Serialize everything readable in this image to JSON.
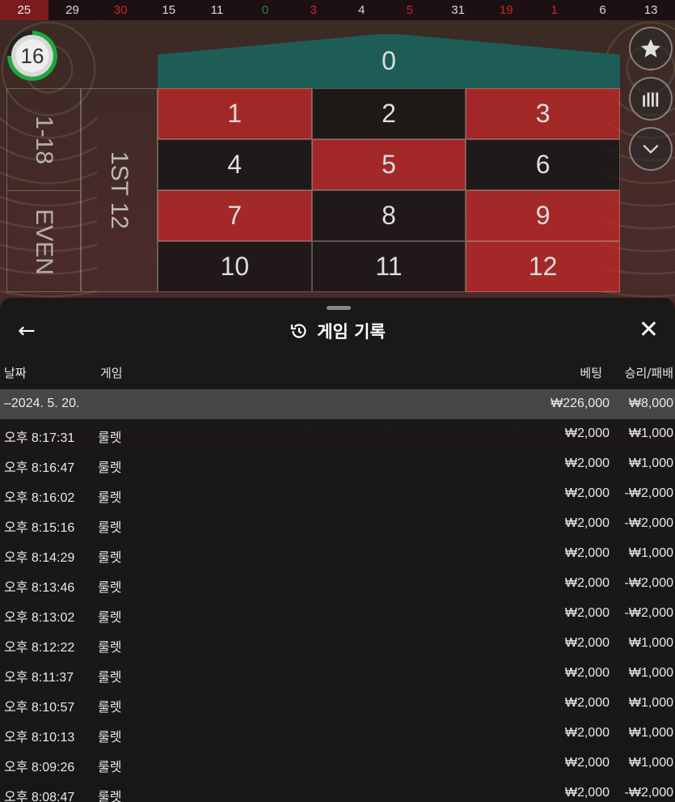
{
  "results": [
    {
      "value": "25",
      "color": "black",
      "latest": true
    },
    {
      "value": "29",
      "color": "black"
    },
    {
      "value": "30",
      "color": "red"
    },
    {
      "value": "15",
      "color": "black"
    },
    {
      "value": "11",
      "color": "black"
    },
    {
      "value": "0",
      "color": "green"
    },
    {
      "value": "3",
      "color": "red"
    },
    {
      "value": "4",
      "color": "black"
    },
    {
      "value": "5",
      "color": "red"
    },
    {
      "value": "31",
      "color": "black"
    },
    {
      "value": "19",
      "color": "red"
    },
    {
      "value": "1",
      "color": "red"
    },
    {
      "value": "6",
      "color": "black"
    },
    {
      "value": "13",
      "color": "black"
    }
  ],
  "timer": "16",
  "side_buttons": [
    "star-icon",
    "statistics-icon",
    "chevron-down-icon"
  ],
  "table": {
    "zero": "0",
    "cells": [
      {
        "n": "1",
        "c": "red"
      },
      {
        "n": "2",
        "c": "black"
      },
      {
        "n": "3",
        "c": "red"
      },
      {
        "n": "4",
        "c": "black"
      },
      {
        "n": "5",
        "c": "red"
      },
      {
        "n": "6",
        "c": "black"
      },
      {
        "n": "7",
        "c": "red"
      },
      {
        "n": "8",
        "c": "black"
      },
      {
        "n": "9",
        "c": "red"
      },
      {
        "n": "10",
        "c": "black"
      },
      {
        "n": "11",
        "c": "black"
      },
      {
        "n": "12",
        "c": "red"
      }
    ],
    "low_label": "1-18",
    "even_label": "EVEN",
    "dozen_label": "1ST 12"
  },
  "colors": {
    "red": "#c8262b",
    "green": "#1d5d56",
    "panel": "#161616"
  },
  "panel": {
    "title": "게임 기록",
    "columns": {
      "date": "날짜",
      "game": "게임",
      "bet": "베팅",
      "result": "승리/패배"
    },
    "date_row": {
      "date": "–2024. 5. 20.",
      "bet": "₩226,000",
      "result": "₩8,000"
    },
    "rows": [
      {
        "time": "오후 8:17:31",
        "game": "룰렛",
        "bet": "₩2,000",
        "result": "₩1,000"
      },
      {
        "time": "오후 8:16:47",
        "game": "룰렛",
        "bet": "₩2,000",
        "result": "₩1,000"
      },
      {
        "time": "오후 8:16:02",
        "game": "룰렛",
        "bet": "₩2,000",
        "result": "-₩2,000"
      },
      {
        "time": "오후 8:15:16",
        "game": "룰렛",
        "bet": "₩2,000",
        "result": "-₩2,000"
      },
      {
        "time": "오후 8:14:29",
        "game": "룰렛",
        "bet": "₩2,000",
        "result": "₩1,000"
      },
      {
        "time": "오후 8:13:46",
        "game": "룰렛",
        "bet": "₩2,000",
        "result": "-₩2,000"
      },
      {
        "time": "오후 8:13:02",
        "game": "룰렛",
        "bet": "₩2,000",
        "result": "-₩2,000"
      },
      {
        "time": "오후 8:12:22",
        "game": "룰렛",
        "bet": "₩2,000",
        "result": "₩1,000"
      },
      {
        "time": "오후 8:11:37",
        "game": "룰렛",
        "bet": "₩2,000",
        "result": "₩1,000"
      },
      {
        "time": "오후 8:10:57",
        "game": "룰렛",
        "bet": "₩2,000",
        "result": "₩1,000"
      },
      {
        "time": "오후 8:10:13",
        "game": "룰렛",
        "bet": "₩2,000",
        "result": "₩1,000"
      },
      {
        "time": "오후 8:09:26",
        "game": "룰렛",
        "bet": "₩2,000",
        "result": "₩1,000"
      },
      {
        "time": "오후 8:08:47",
        "game": "룰렛",
        "bet": "₩2,000",
        "result": "-₩2,000"
      }
    ]
  }
}
